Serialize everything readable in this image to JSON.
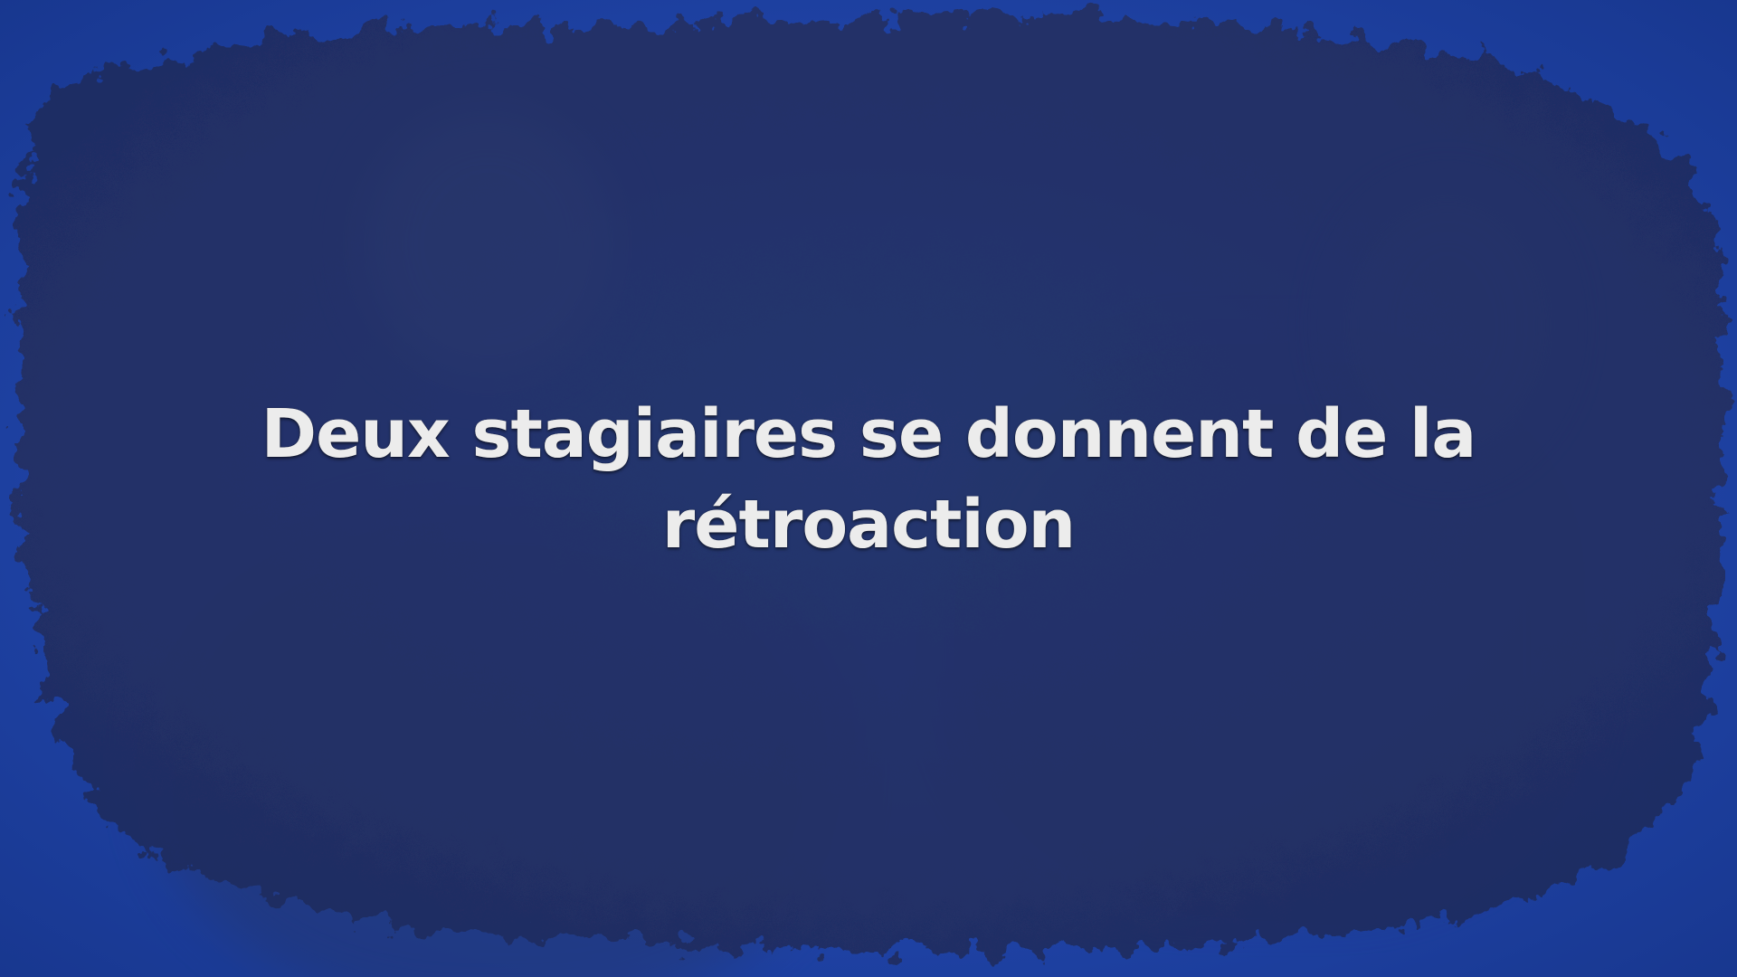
{
  "title": {
    "line1": "Deux stagiaires se donnent de la",
    "line2": "rétroaction"
  },
  "colors": {
    "outer_blue": "#1f43a6",
    "inner_navy": "#232f63",
    "text": "#ececec"
  }
}
